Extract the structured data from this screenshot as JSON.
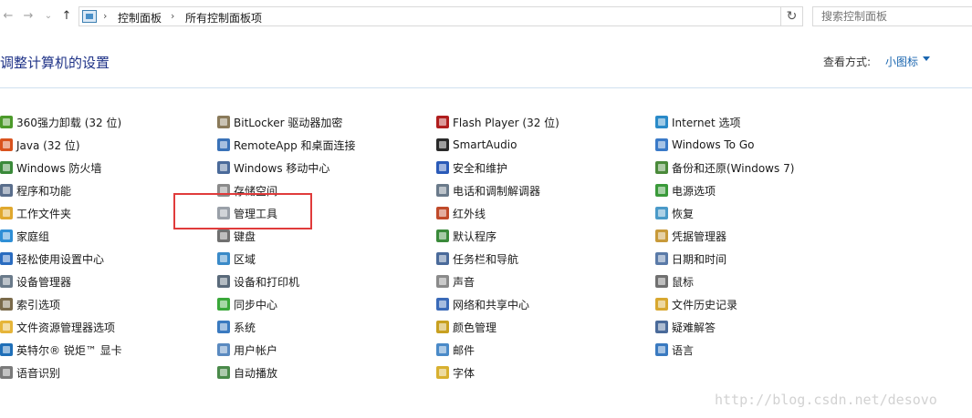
{
  "address_bar": {
    "back_glyph": "←",
    "forward_glyph": "→",
    "recent_glyph": "⌄",
    "up_glyph": "↑",
    "breadcrumbs": [
      "控制面板",
      "所有控制面板项"
    ],
    "separator": "›",
    "refresh_glyph": "↻",
    "search_placeholder": "搜索控制面板"
  },
  "header": {
    "title": "调整计算机的设置",
    "view_by_label": "查看方式:",
    "view_by_value": "小图标"
  },
  "columns": [
    [
      {
        "label": "360强力卸载 (32 位)",
        "icon": "uninstall-icon",
        "color": "#4c9a2a"
      },
      {
        "label": "Java (32 位)",
        "icon": "java-icon",
        "color": "#d9531e"
      },
      {
        "label": "Windows 防火墙",
        "icon": "firewall-icon",
        "color": "#3a8a3a"
      },
      {
        "label": "程序和功能",
        "icon": "programs-icon",
        "color": "#5a6e8c"
      },
      {
        "label": "工作文件夹",
        "icon": "work-folders-icon",
        "color": "#e0a82e"
      },
      {
        "label": "家庭组",
        "icon": "homegroup-icon",
        "color": "#2f8fd6"
      },
      {
        "label": "轻松使用设置中心",
        "icon": "ease-of-access-icon",
        "color": "#2a6cc0"
      },
      {
        "label": "设备管理器",
        "icon": "device-manager-icon",
        "color": "#6a7a8a"
      },
      {
        "label": "索引选项",
        "icon": "indexing-icon",
        "color": "#7a6a4a"
      },
      {
        "label": "文件资源管理器选项",
        "icon": "folder-options-icon",
        "color": "#e6b53a"
      },
      {
        "label": "英特尔® 锐炬™ 显卡",
        "icon": "intel-graphics-icon",
        "color": "#1f6fb8"
      },
      {
        "label": "语音识别",
        "icon": "speech-icon",
        "color": "#7a7a7a"
      }
    ],
    [
      {
        "label": "BitLocker 驱动器加密",
        "icon": "bitlocker-icon",
        "color": "#8a7a5a"
      },
      {
        "label": "RemoteApp 和桌面连接",
        "icon": "remoteapp-icon",
        "color": "#3a72b8"
      },
      {
        "label": "Windows 移动中心",
        "icon": "mobility-center-icon",
        "color": "#4a6a9a"
      },
      {
        "label": "存储空间",
        "icon": "storage-spaces-icon",
        "color": "#8a8a8a"
      },
      {
        "label": "管理工具",
        "icon": "admin-tools-icon",
        "color": "#9aa0a8"
      },
      {
        "label": "键盘",
        "icon": "keyboard-icon",
        "color": "#707070"
      },
      {
        "label": "区域",
        "icon": "region-icon",
        "color": "#3a8ac8"
      },
      {
        "label": "设备和打印机",
        "icon": "printer-icon",
        "color": "#5a6a7a"
      },
      {
        "label": "同步中心",
        "icon": "sync-icon",
        "color": "#3aa83a"
      },
      {
        "label": "系统",
        "icon": "system-icon",
        "color": "#3a7ac0"
      },
      {
        "label": "用户帐户",
        "icon": "user-accounts-icon",
        "color": "#5a8ac0"
      },
      {
        "label": "自动播放",
        "icon": "autoplay-icon",
        "color": "#4a8a4a"
      }
    ],
    [
      {
        "label": "Flash Player (32 位)",
        "icon": "flash-icon",
        "color": "#b01e1e"
      },
      {
        "label": "SmartAudio",
        "icon": "smartaudio-icon",
        "color": "#2a2a2a"
      },
      {
        "label": "安全和维护",
        "icon": "security-flag-icon",
        "color": "#2a5ab8"
      },
      {
        "label": "电话和调制解调器",
        "icon": "phone-modem-icon",
        "color": "#6a7a8a"
      },
      {
        "label": "红外线",
        "icon": "infrared-icon",
        "color": "#c04a2a"
      },
      {
        "label": "默认程序",
        "icon": "default-programs-icon",
        "color": "#3a8a3a"
      },
      {
        "label": "任务栏和导航",
        "icon": "taskbar-icon",
        "color": "#4a6a9a"
      },
      {
        "label": "声音",
        "icon": "sound-icon",
        "color": "#8a8a8a"
      },
      {
        "label": "网络和共享中心",
        "icon": "network-icon",
        "color": "#3a6ab8"
      },
      {
        "label": "颜色管理",
        "icon": "color-management-icon",
        "color": "#c8a020"
      },
      {
        "label": "邮件",
        "icon": "mail-icon",
        "color": "#4a8ac8"
      },
      {
        "label": "字体",
        "icon": "fonts-icon",
        "color": "#d8b030"
      }
    ],
    [
      {
        "label": "Internet 选项",
        "icon": "internet-options-icon",
        "color": "#2a8ac8"
      },
      {
        "label": "Windows To Go",
        "icon": "windows-to-go-icon",
        "color": "#3a7ac8"
      },
      {
        "label": "备份和还原(Windows 7)",
        "icon": "backup-icon",
        "color": "#4a8a3a"
      },
      {
        "label": "电源选项",
        "icon": "power-options-icon",
        "color": "#3a9a3a"
      },
      {
        "label": "恢复",
        "icon": "recovery-icon",
        "color": "#4a9ac8"
      },
      {
        "label": "凭据管理器",
        "icon": "credential-icon",
        "color": "#c89a3a"
      },
      {
        "label": "日期和时间",
        "icon": "clock-icon",
        "color": "#5a7aa8"
      },
      {
        "label": "鼠标",
        "icon": "mouse-icon",
        "color": "#707070"
      },
      {
        "label": "文件历史记录",
        "icon": "file-history-icon",
        "color": "#d8a830"
      },
      {
        "label": "疑难解答",
        "icon": "troubleshoot-icon",
        "color": "#4a6a9a"
      },
      {
        "label": "语言",
        "icon": "language-icon",
        "color": "#3a7ac0"
      }
    ]
  ],
  "watermark": "http://blog.csdn.net/desovo"
}
